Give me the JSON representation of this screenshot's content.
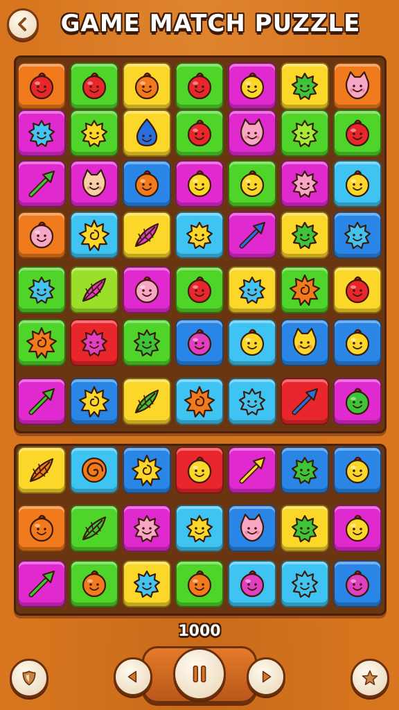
{
  "header": {
    "title": "GAME MATCH PUZZLE",
    "back_icon": "chevron-left-icon"
  },
  "score": {
    "value": "1000"
  },
  "controls": {
    "left_icon": "shield-icon",
    "prev_icon": "triangle-left-icon",
    "pause_icon": "pause-icon",
    "next_icon": "triangle-right-icon",
    "right_icon": "star-icon"
  },
  "colors": {
    "orange": "#f07a1c",
    "green": "#4fd42a",
    "yellow": "#fbd72a",
    "magenta": "#e02ad0",
    "blue": "#2a86e6",
    "cyan": "#3fc3f2",
    "red": "#e8262b",
    "lime": "#9ae02a"
  },
  "boards": {
    "top": [
      [
        [
          "orange",
          "blob",
          "red"
        ],
        [
          "green",
          "blob",
          "red"
        ],
        [
          "yellow",
          "blob",
          "orange"
        ],
        [
          "green",
          "blob",
          "red"
        ],
        [
          "magenta",
          "blob",
          "yellow"
        ],
        [
          "yellow",
          "spiky",
          "green"
        ],
        [
          "orange",
          "cat",
          "pink"
        ]
      ],
      [
        [
          "magenta",
          "spiky",
          "cyan"
        ],
        [
          "green",
          "spiky",
          "yellow"
        ],
        [
          "yellow",
          "drop",
          "blue"
        ],
        [
          "green",
          "blob",
          "red"
        ],
        [
          "magenta",
          "cat",
          "pink"
        ],
        [
          "green",
          "spiky",
          "lime"
        ],
        [
          "green",
          "blob",
          "red"
        ]
      ],
      [
        [
          "magenta",
          "arrow",
          "green"
        ],
        [
          "magenta",
          "cat",
          "peach"
        ],
        [
          "blue",
          "blob",
          "orange"
        ],
        [
          "magenta",
          "blob",
          "yellow"
        ],
        [
          "green",
          "blob",
          "yellow"
        ],
        [
          "magenta",
          "spiky",
          "pink"
        ],
        [
          "cyan",
          "blob",
          "yellow"
        ]
      ],
      [
        [
          "orange",
          "blob",
          "pink"
        ],
        [
          "cyan",
          "sun",
          "yellow"
        ],
        [
          "yellow",
          "leaf",
          "magenta"
        ],
        [
          "cyan",
          "spiky",
          "yellow"
        ],
        [
          "magenta",
          "arrow",
          "blue"
        ],
        [
          "yellow",
          "spiky",
          "green"
        ],
        [
          "blue",
          "spiky",
          "cyan"
        ]
      ],
      [
        [
          "green",
          "spiky",
          "cyan"
        ],
        [
          "lime",
          "leaf",
          "magenta"
        ],
        [
          "magenta",
          "blob",
          "pink"
        ],
        [
          "green",
          "blob",
          "red"
        ],
        [
          "yellow",
          "spiky",
          "cyan"
        ],
        [
          "green",
          "sun",
          "orange"
        ],
        [
          "yellow",
          "blob",
          "red"
        ]
      ],
      [
        [
          "green",
          "sun",
          "orange"
        ],
        [
          "red",
          "spiky",
          "magenta"
        ],
        [
          "green",
          "spiky",
          "green"
        ],
        [
          "blue",
          "blob",
          "magenta"
        ],
        [
          "cyan",
          "blob",
          "yellow"
        ],
        [
          "blue",
          "cat",
          "yellow"
        ],
        [
          "blue",
          "blob",
          "yellow"
        ]
      ],
      [
        [
          "magenta",
          "arrow",
          "green"
        ],
        [
          "blue",
          "sun",
          "yellow"
        ],
        [
          "yellow",
          "leaf",
          "green"
        ],
        [
          "cyan",
          "sun",
          "orange"
        ],
        [
          "cyan",
          "spiky",
          "cyan"
        ],
        [
          "red",
          "arrow",
          "blue"
        ],
        [
          "magenta",
          "blob",
          "green"
        ]
      ]
    ],
    "bottom": [
      [
        [
          "yellow",
          "leaf",
          "orange"
        ],
        [
          "cyan",
          "swirl",
          "orange"
        ],
        [
          "blue",
          "sun",
          "yellow"
        ],
        [
          "red",
          "blob",
          "yellow"
        ],
        [
          "magenta",
          "arrow",
          "yellow"
        ],
        [
          "blue",
          "spiky",
          "green"
        ],
        [
          "blue",
          "blob",
          "yellow"
        ]
      ],
      [
        [
          "orange",
          "blob",
          "orange"
        ],
        [
          "green",
          "leaf",
          "green"
        ],
        [
          "magenta",
          "spiky",
          "pink"
        ],
        [
          "cyan",
          "spiky",
          "yellow"
        ],
        [
          "blue",
          "cat",
          "pink"
        ],
        [
          "yellow",
          "spiky",
          "green"
        ],
        [
          "magenta",
          "blob",
          "yellow"
        ]
      ],
      [
        [
          "magenta",
          "arrow",
          "green"
        ],
        [
          "green",
          "blob",
          "orange"
        ],
        [
          "yellow",
          "spiky",
          "cyan"
        ],
        [
          "green",
          "blob",
          "orange"
        ],
        [
          "cyan",
          "blob",
          "magenta"
        ],
        [
          "cyan",
          "spiky",
          "cyan"
        ],
        [
          "blue",
          "blob",
          "magenta"
        ]
      ]
    ]
  }
}
